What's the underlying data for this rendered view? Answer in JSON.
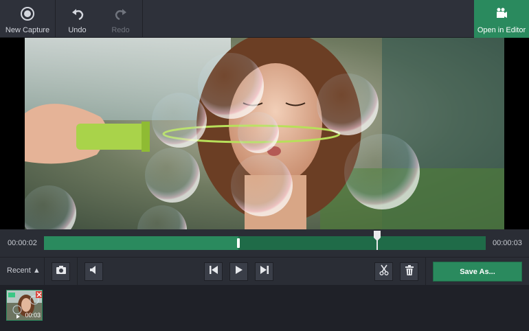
{
  "toolbar": {
    "new_capture": "New Capture",
    "undo": "Undo",
    "redo": "Redo",
    "open_in_editor": "Open in Editor"
  },
  "timeline": {
    "start_time": "00:00:02",
    "end_time": "00:00:03",
    "progress_fraction": 0.44,
    "playhead_fraction": 0.755
  },
  "controls": {
    "recent_label": "Recent ▲",
    "save_as_label": "Save As..."
  },
  "recent": {
    "items": [
      {
        "duration": "00:03"
      }
    ]
  },
  "colors": {
    "accent": "#2a8a5e",
    "accent_dark": "#1f6b48",
    "toolbar_bg": "#2e313a",
    "panel_bg": "#2a2d35"
  },
  "icons": {
    "new_capture": "record-icon",
    "undo": "undo-icon",
    "redo": "redo-icon",
    "open_in_editor": "editor-camera-icon",
    "screenshot": "camera-icon",
    "volume": "speaker-icon",
    "prev": "skip-back-icon",
    "play": "play-icon",
    "next": "skip-forward-icon",
    "cut": "scissors-icon",
    "delete": "trash-icon",
    "thumb_delete": "close-icon",
    "thumb_folder": "folder-icon"
  }
}
